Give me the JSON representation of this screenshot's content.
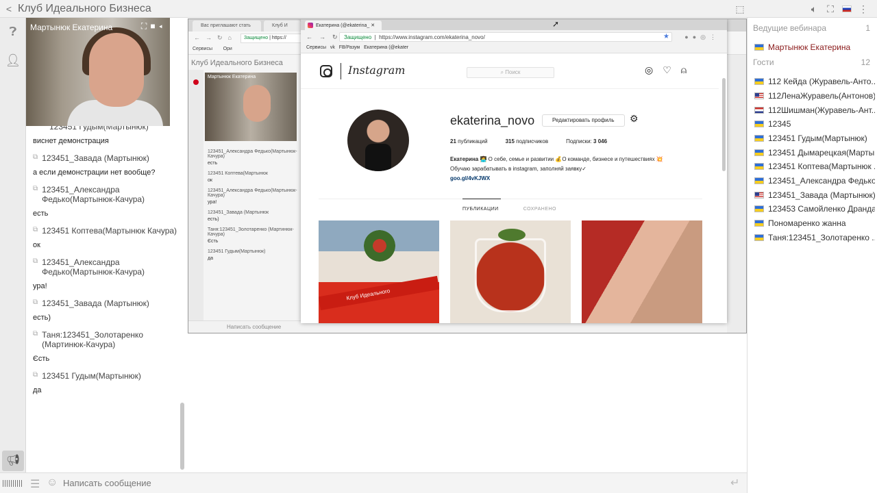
{
  "app": {
    "title": "Клуб Идеального Бизнеса"
  },
  "webcam": {
    "name": "Мартынюк Екатерина"
  },
  "chat": {
    "partial_top": "123451 Гудым(Мартынюк)",
    "messages": [
      {
        "author": "",
        "text": "виснет демонстрация"
      },
      {
        "author": "123451_Завада (Мартынюк)",
        "text": "а если демонстрации нет вообще?"
      },
      {
        "author": "123451_Александра Федько(Мартынюк-Качура)",
        "text": "есть"
      },
      {
        "author": "123451 Коптева(Мартынюк Качура)",
        "text": "ок"
      },
      {
        "author": "123451_Александра Федько(Мартынюк-Качура)",
        "text": "ура!"
      },
      {
        "author": "123451_Завада (Мартынюк)",
        "text": "есть)"
      },
      {
        "author": "Таня:123451_Золотаренко (Мартинюк-Качура)",
        "text": "Єсть"
      },
      {
        "author": "123451 Гудым(Мартынюк)",
        "text": "да"
      }
    ],
    "input_placeholder": "Написать сообщение"
  },
  "screen": {
    "outer_tabs": [
      "Вас приглашают стать",
      "Клуб И"
    ],
    "outer_url_secure": "Защищено",
    "outer_url": "https://",
    "outer_bookmarks": "Сервисы",
    "outer_bookmark_more": "Ори",
    "mini_app_title": "Клуб Идеального Бизнеса",
    "mini_cam_name": "Мартынюк Екатерина",
    "mini_chat": [
      {
        "author": "123451_Александра Федько(Мартынюк-Качура)",
        "text": "есть"
      },
      {
        "author": "123451 Коптева(Мартынюк",
        "text": "ок"
      },
      {
        "author": "123451_Александра Федько(Мартынюк-Качура)",
        "text": "ура!"
      },
      {
        "author": "123451_Завада (Мартынюк",
        "text": "есть)"
      },
      {
        "author": "Таня:123451_Золотаренко (Мартинюк-Качура)",
        "text": "Єсть"
      },
      {
        "author": "123451 Гудым(Мартынюк)",
        "text": "да"
      }
    ],
    "mini_input": "Написать сообщение",
    "browser": {
      "tab_title": "Екатерина (@ekaterina_",
      "secure": "Защищено",
      "url": "https://www.instagram.com/ekaterina_novo/",
      "bookmarks": [
        "Сервисы",
        "vk",
        "FB/Разум",
        "Екатерина (@ekater"
      ],
      "instagram": {
        "wordmark": "Instagram",
        "search_placeholder": "Поиск",
        "username": "ekaterina_novo",
        "edit_button": "Редактировать профиль",
        "posts_count": "21",
        "posts_label": "публикаций",
        "followers_count": "315",
        "followers_label": "подписчиков",
        "following_label": "Подписки:",
        "following_count": "3 046",
        "bio_name": "Екатерина",
        "bio_line1": "О себе, семье и развитии",
        "bio_line1b": "О команде, бизнесе и путешествиях",
        "bio_line2": "Обучаю зарабатывать в instagram, заполняй заявку",
        "bio_link": "goo.gl/4vKJWX",
        "tab_posts": "ПУБЛИКАЦИИ",
        "tab_saved": "СОХРАНЕНО",
        "band_text": "Клуб Идеального"
      }
    }
  },
  "right_panel": {
    "hosts_label": "Ведущие вебинара",
    "hosts_count": "1",
    "host": "Мартынюк Екатерина",
    "guests_label": "Гости",
    "guests_count": "12",
    "guests": [
      {
        "name": "112 Кейда (Журавель-Анто...",
        "flag": "ua"
      },
      {
        "name": "112ЛенаЖуравель(Антонов)",
        "flag": "us"
      },
      {
        "name": "112Шишман(Журавель-Ант...",
        "flag": "nl"
      },
      {
        "name": "12345",
        "flag": "ua"
      },
      {
        "name": "123451 Гудым(Мартынюк)",
        "flag": "ua"
      },
      {
        "name": "123451 Дымарецкая(Марты...",
        "flag": "ua"
      },
      {
        "name": "123451 Коптева(Мартынюк ...",
        "flag": "ua"
      },
      {
        "name": "123451_Александра Федько...",
        "flag": "ua"
      },
      {
        "name": "123451_Завада (Мартынюк)",
        "flag": "us"
      },
      {
        "name": "123453 Самойленко Дранда...",
        "flag": "ua"
      },
      {
        "name": "Пономаренко жанна",
        "flag": "ua"
      },
      {
        "name": "Таня:123451_Золотаренко ...",
        "flag": "ua"
      }
    ]
  }
}
